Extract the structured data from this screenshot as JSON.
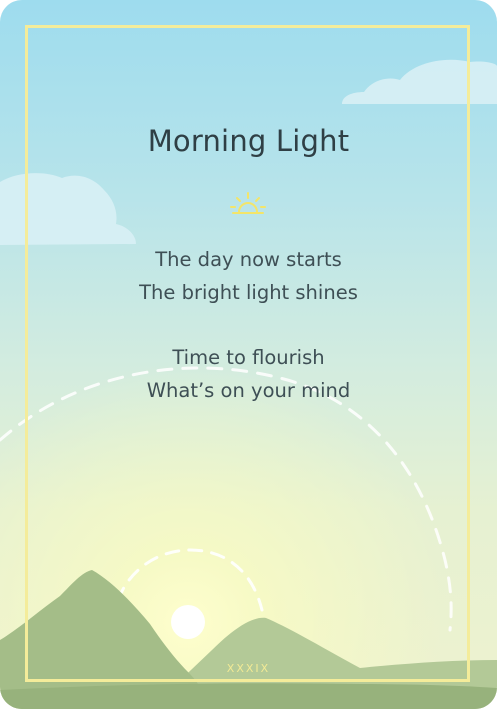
{
  "card": {
    "title": "Morning Light",
    "stanzas": [
      [
        "The day now starts",
        "The bright light shines"
      ],
      [
        "Time to flourish",
        "What’s on your mind"
      ]
    ],
    "numeral": "XXXIX",
    "icon": "sunrise-icon"
  },
  "colors": {
    "frame": "#f4ec9a",
    "sky_top": "#9edcee",
    "sky_bottom": "#eef2cf",
    "hills": "#a7c08b",
    "text": "#3e4f55"
  }
}
